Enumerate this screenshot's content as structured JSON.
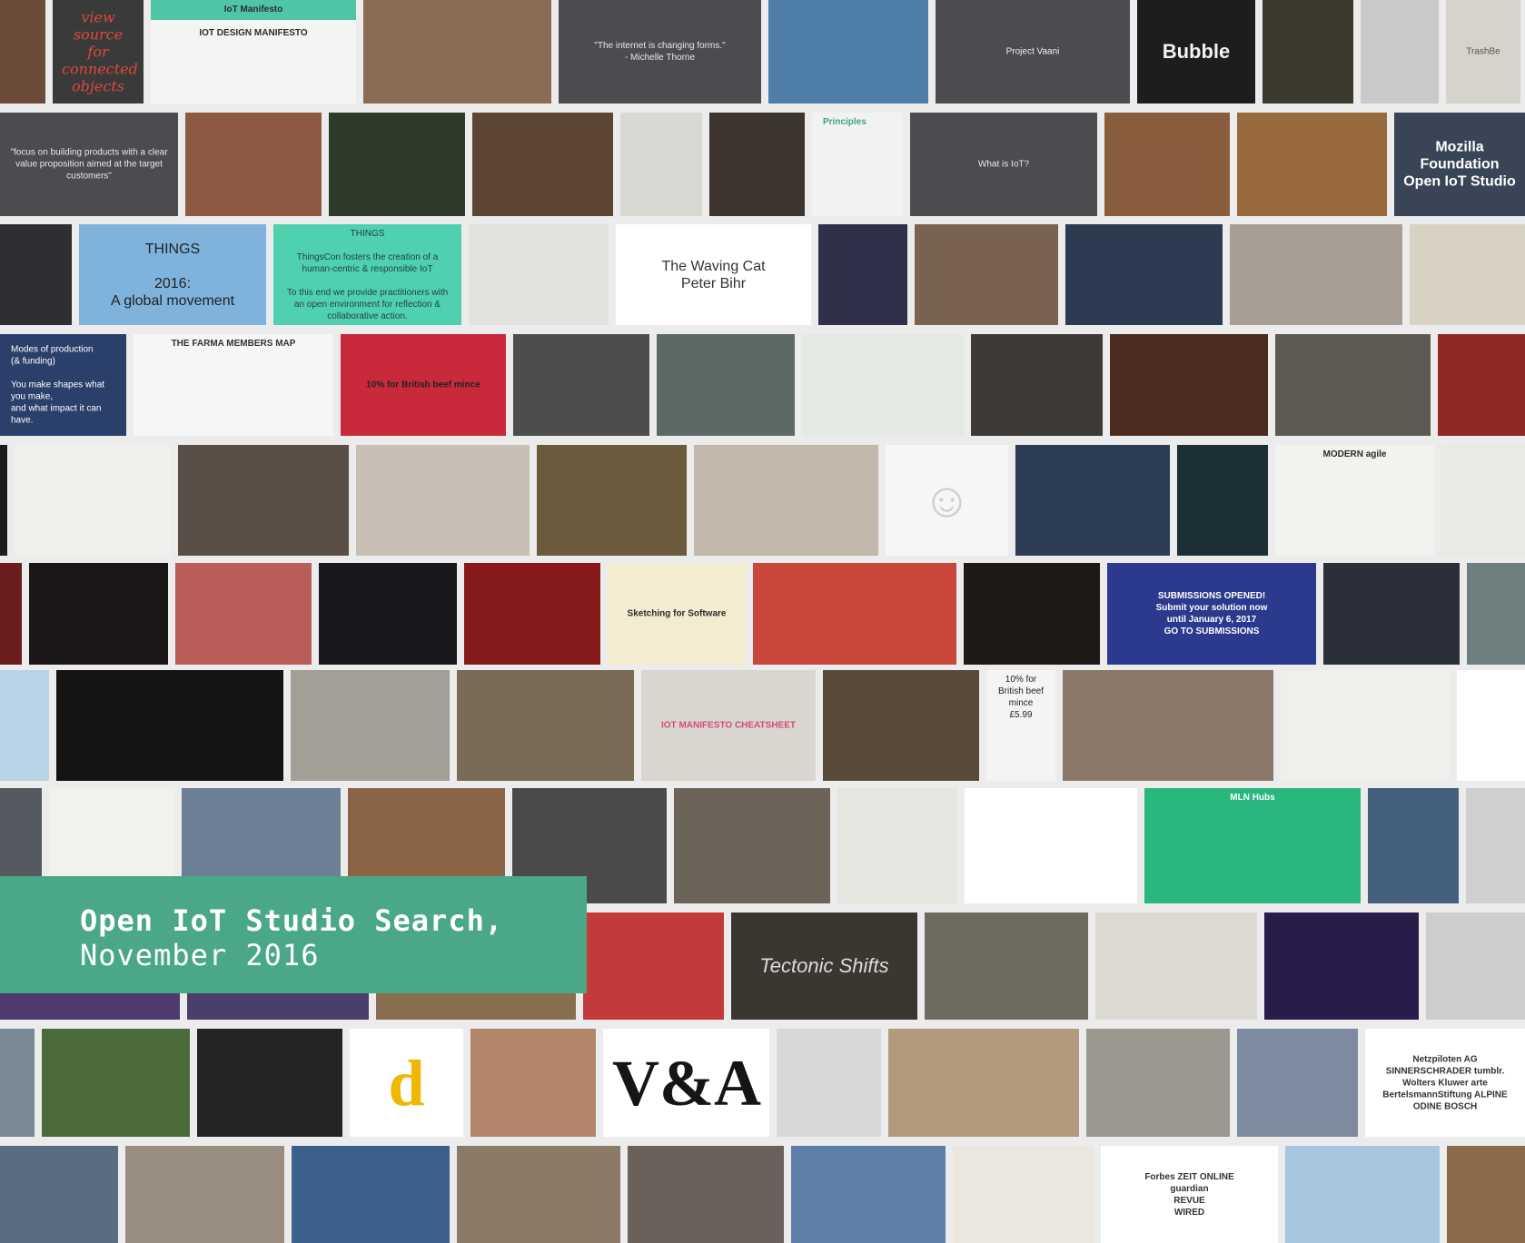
{
  "title": {
    "line1": "Open IoT Studio Search,",
    "line2": "November 2016"
  },
  "rows": [
    {
      "name": "row-1",
      "tiles": [
        {
          "w": 52,
          "bg": "#6b4a3a",
          "name": "workshop-photo-tile"
        },
        {
          "w": 100,
          "bg": "#3b3a3a",
          "text": "view source\nfor\nconnected\nobjects",
          "color": "#e0473a",
          "style": "big script",
          "name": "handwritten-note-tile"
        },
        {
          "w": 226,
          "bg": "#f4f4f2",
          "text": "IoT Manifesto\n\nIOT DESIGN MANIFESTO",
          "color": "#2d2d2d",
          "style": "top bold",
          "band": "#4ec5a5",
          "name": "iot-manifesto-tile"
        },
        {
          "w": 207,
          "bg": "#8a6b55",
          "name": "crowd-photo-tile"
        },
        {
          "w": 223,
          "bg": "#4a4c50",
          "text": "\"The internet is changing forms.\"\n- Michelle Thorne",
          "color": "#e8e8e8",
          "name": "quote-slide-tile"
        },
        {
          "w": 176,
          "bg": "#4f7fa8",
          "name": "coastal-town-photo-tile"
        },
        {
          "w": 214,
          "bg": "#4a4c50",
          "text": "Project Vaani",
          "color": "#f0f0f0",
          "name": "project-vaani-slide-tile"
        },
        {
          "w": 130,
          "bg": "#1d1d1d",
          "text": "Bubble",
          "color": "#f2f2f2",
          "style": "bigger bold",
          "name": "bubble-device-tile"
        },
        {
          "w": 100,
          "bg": "#3c3a2e",
          "name": "audience-photo-tile"
        },
        {
          "w": 86,
          "bg": "#c9c9c9",
          "name": "tablet-video-tile"
        },
        {
          "w": 82,
          "bg": "#d6d2cc",
          "text": "TrashBe",
          "color": "#555555",
          "name": "trashbe-tile"
        }
      ]
    },
    {
      "name": "row-2",
      "tiles": [
        {
          "w": 196,
          "bg": "#4a4c50",
          "text": "\"focus on building products with a clear value proposition aimed at the target customers\"",
          "color": "#e8e8e8",
          "name": "quote-slide-tile"
        },
        {
          "w": 150,
          "bg": "#8e5a43",
          "name": "red-phonebox-photo-tile"
        },
        {
          "w": 150,
          "bg": "#2f3b2a",
          "name": "graffiti-wall-photo-tile"
        },
        {
          "w": 155,
          "bg": "#5d4533",
          "name": "maker-table-photo-tile"
        },
        {
          "w": 90,
          "bg": "#d9d9d4",
          "name": "sketchbook-photo-tile"
        },
        {
          "w": 105,
          "bg": "#3e3530",
          "name": "hand-photo-tile"
        },
        {
          "w": 100,
          "bg": "#f2f2f2",
          "text": "Principles",
          "color": "#3aa57f",
          "style": "top bold left",
          "name": "principles-slide-tile"
        },
        {
          "w": 206,
          "bg": "#4a4c50",
          "text": "What is IoT?",
          "color": "#e8e8e8",
          "name": "what-is-iot-slide-tile"
        },
        {
          "w": 138,
          "bg": "#8a5e3d",
          "name": "studio-interior-photo-tile"
        },
        {
          "w": 165,
          "bg": "#9a6a3f",
          "name": "kitchen-photo-tile"
        },
        {
          "w": 179,
          "bg": "#394556",
          "text": "Mozilla Foundation\nOpen IoT Studio",
          "color": "#ffffff",
          "style": "big bold",
          "name": "mozilla-foundation-tile"
        }
      ]
    },
    {
      "name": "row-3",
      "tiles": [
        {
          "w": 79,
          "bg": "#2d2f33",
          "name": "dark-code-slide-tile"
        },
        {
          "w": 206,
          "bg": "#7fb3dc",
          "text": "THINGS\n\n2016:\nA global movement",
          "color": "#222222",
          "style": "big",
          "name": "global-movement-map-tile"
        },
        {
          "w": 207,
          "bg": "#4fd1b1",
          "text": "THINGS\n\nThingsCon fosters the creation of a human-centric & responsible IoT\n\nTo this end we provide practitioners with an open environment for reflection & collaborative action.",
          "color": "#1f3d4a",
          "name": "thingscon-slide-tile"
        },
        {
          "w": 154,
          "bg": "#e3e1dc",
          "name": "drawing-sheet-tile"
        },
        {
          "w": 215,
          "bg": "#ffffff",
          "text": "The Waving Cat\nPeter Bihr",
          "color": "#333333",
          "style": "big",
          "name": "waving-cat-slide-tile"
        },
        {
          "w": 98,
          "bg": "#30304a",
          "name": "baby-photo-tile"
        },
        {
          "w": 158,
          "bg": "#7a6250",
          "name": "children-group-photo-tile"
        },
        {
          "w": 173,
          "bg": "#2d3b52",
          "name": "classroom-photo-tile"
        },
        {
          "w": 190,
          "bg": "#a79f95",
          "name": "cardboard-device-photo-tile"
        },
        {
          "w": 159,
          "bg": "#d8d2c3",
          "name": "sensor-board-photo-tile"
        }
      ]
    },
    {
      "name": "row-4",
      "tiles": [
        {
          "w": 139,
          "bg": "#2b3f6b",
          "text": "Modes of production\n(& funding)\n\nYou make shapes what you make,\nand what impact it can have.",
          "color": "#ffffff",
          "style": "left",
          "name": "modes-of-production-slide-tile"
        },
        {
          "w": 220,
          "bg": "#f6f6f6",
          "text": "THE FARMA MEMBERS MAP",
          "color": "#333333",
          "style": "top bold",
          "name": "farma-members-map-tile"
        },
        {
          "w": 182,
          "bg": "#c82a3c",
          "text": "10% for British beef mince",
          "color": "#222222",
          "style": "bold",
          "name": "mince-package-tile"
        },
        {
          "w": 150,
          "bg": "#4d4d4d",
          "name": "bubble-prototype-photo-tile"
        },
        {
          "w": 152,
          "bg": "#5b6a66",
          "name": "rocky-shore-photo-tile"
        },
        {
          "w": 178,
          "bg": "#e5e9e4",
          "name": "map-pins-tile"
        },
        {
          "w": 145,
          "bg": "#3e3a36",
          "name": "selfie-photo-tile"
        },
        {
          "w": 174,
          "bg": "#4a2d20",
          "name": "crowd-audience-photo-tile"
        },
        {
          "w": 171,
          "bg": "#5d5a52",
          "name": "boat-photo-tile"
        },
        {
          "w": 148,
          "bg": "#8e2a26",
          "name": "phonebox-garden-photo-tile"
        }
      ]
    },
    {
      "name": "row-5",
      "tiles": [
        {
          "w": 8,
          "bg": "#1d1d1d",
          "name": "edge-photo-tile"
        },
        {
          "w": 172,
          "bg": "#f0f0ec",
          "name": "circuit-sketch-tile"
        },
        {
          "w": 188,
          "bg": "#5a4f46",
          "name": "laser-cutter-photo-tile"
        },
        {
          "w": 191,
          "bg": "#c7bfb3",
          "name": "wooden-box-led-tile"
        },
        {
          "w": 165,
          "bg": "#6b5a3c",
          "name": "hall-interior-photo-tile"
        },
        {
          "w": 203,
          "bg": "#c2b8ab",
          "name": "led-clock-box-tile"
        },
        {
          "w": 135,
          "bg": "#f6f6f6",
          "glyph": "☺",
          "color": "#cfcfcf",
          "name": "group-avatar-icon"
        },
        {
          "w": 170,
          "bg": "#2c3c55",
          "name": "workshop-room-photo-tile"
        },
        {
          "w": 100,
          "bg": "#1c2e36",
          "name": "presenter-screen-photo-tile"
        },
        {
          "w": 175,
          "bg": "#f2f2ee",
          "text": "MODERN agile",
          "color": "#2a2a2a",
          "style": "top bold",
          "name": "modern-agile-sketchnote-tile"
        },
        {
          "w": 150,
          "bg": "#e9eae6",
          "name": "circuit-board-photo-tile"
        }
      ]
    },
    {
      "name": "row-6",
      "tiles": [
        {
          "w": 24,
          "bg": "#6a1d1d",
          "name": "edge-photo-tile"
        },
        {
          "w": 153,
          "bg": "#1a1716",
          "name": "night-hall-photo-tile"
        },
        {
          "w": 150,
          "bg": "#b85d58",
          "name": "party-photo-tile"
        },
        {
          "w": 152,
          "bg": "#19191d",
          "name": "night-building-photo-tile"
        },
        {
          "w": 150,
          "bg": "#861a1a",
          "name": "red-hall-photo-tile"
        },
        {
          "w": 152,
          "bg": "#f4ecd0",
          "text": "Sketching for Software",
          "color": "#2a2a2a",
          "style": "bold",
          "name": "sketching-for-software-tile"
        },
        {
          "w": 224,
          "bg": "#c8473a",
          "name": "octopus-tentacle-photo-tile"
        },
        {
          "w": 150,
          "bg": "#1e1a17",
          "name": "illuminated-facade-photo-tile"
        },
        {
          "w": 230,
          "bg": "#2b3a8c",
          "text": "SUBMISSIONS OPENED!\nSubmit your solution now\nuntil January 6, 2017\nGO TO SUBMISSIONS",
          "color": "#ffffff",
          "style": "bold",
          "name": "submissions-opened-banner-tile"
        },
        {
          "w": 150,
          "bg": "#2a2f3a",
          "name": "presentation-screen-photo-tile"
        },
        {
          "w": 94,
          "bg": "#6f7e7e",
          "name": "lab-equipment-photo-tile"
        }
      ]
    },
    {
      "name": "row-7",
      "tiles": [
        {
          "w": 54,
          "bg": "#b9d3e6",
          "name": "map-edge-tile"
        },
        {
          "w": 250,
          "bg": "#141414",
          "name": "portrait-photo-tile"
        },
        {
          "w": 175,
          "bg": "#a39f97",
          "name": "metal-sculpture-photo-tile"
        },
        {
          "w": 195,
          "bg": "#7a6a58",
          "name": "exhibition-photo-tile"
        },
        {
          "w": 192,
          "bg": "#d9d6cf",
          "text": "IOT MANIFESTO CHEATSHEET",
          "color": "#d24a7a",
          "style": "bold",
          "name": "manifesto-cheatsheet-photo-tile"
        },
        {
          "w": 172,
          "bg": "#5a4a3c",
          "name": "wooden-shelf-photo-tile"
        },
        {
          "w": 76,
          "bg": "#f4f4f4",
          "text": "10% for British beef mince\n£5.99",
          "color": "#222222",
          "style": "top",
          "name": "mince-label-tile"
        },
        {
          "w": 232,
          "bg": "#8a7968",
          "name": "meeting-table-photo-tile"
        },
        {
          "w": 186,
          "bg": "#f0efec",
          "name": "product-box-photo-tile"
        },
        {
          "w": 125,
          "bg": "#ffffff",
          "name": "pixel-art-character-tile"
        }
      ]
    },
    {
      "name": "row-8",
      "tiles": [
        {
          "w": 46,
          "bg": "#555a60",
          "name": "edge-photo-tile"
        },
        {
          "w": 138,
          "bg": "#f3f1ed",
          "name": "smiling-woman-photo-tile"
        },
        {
          "w": 175,
          "bg": "#6d7f95",
          "name": "harbour-photo-tile"
        },
        {
          "w": 173,
          "bg": "#8a6447",
          "name": "tabletop-game-photo-tile"
        },
        {
          "w": 170,
          "bg": "#4b4a4a",
          "name": "open-office-photo-tile"
        },
        {
          "w": 172,
          "bg": "#6c6458",
          "name": "networking-event-photo-tile"
        },
        {
          "w": 132,
          "bg": "#e7e5e0",
          "name": "man-portrait-photo-tile"
        },
        {
          "w": 190,
          "bg": "#ffffff",
          "name": "signal-flags-chart-tile"
        },
        {
          "w": 238,
          "bg": "#29b77d",
          "text": "MLN Hubs",
          "color": "#ffffff",
          "style": "top bold",
          "name": "mln-hubs-slide-tile"
        },
        {
          "w": 100,
          "bg": "#45607c",
          "name": "overhead-workshop-photo-tile"
        },
        {
          "w": 100,
          "bg": "#cfcfcf",
          "name": "wood-sign-photo-tile"
        }
      ]
    },
    {
      "name": "row-9",
      "tiles": [
        {
          "w": 198,
          "bg": "#4e3a6c",
          "name": "purple-edge-tile"
        },
        {
          "w": 200,
          "bg": "#4a3f6a",
          "name": "purple-slide-tile"
        },
        {
          "w": 220,
          "bg": "#8a6e50",
          "name": "wood-edge-tile"
        },
        {
          "w": 155,
          "bg": "#c43a3a",
          "name": "conference-stage-photo-tile"
        },
        {
          "w": 205,
          "bg": "#3b3630",
          "text": "Tectonic Shifts",
          "color": "#dcdcdc",
          "style": "bigger italic",
          "name": "tectonic-shifts-slide-tile"
        },
        {
          "w": 180,
          "bg": "#6e6a60",
          "name": "chalkboard-people-photo-tile"
        },
        {
          "w": 178,
          "bg": "#dcd8d2",
          "name": "photo-collage-tile"
        },
        {
          "w": 170,
          "bg": "#2a1c4a",
          "name": "stage-lights-photo-tile"
        },
        {
          "w": 173,
          "bg": "#cdcdcd",
          "name": "white-gallery-photo-tile"
        }
      ]
    },
    {
      "name": "row-10",
      "tiles": [
        {
          "w": 38,
          "bg": "#7a8894",
          "name": "edge-photo-tile"
        },
        {
          "w": 163,
          "bg": "#4c6a3a",
          "name": "solar-panel-photo-tile"
        },
        {
          "w": 160,
          "bg": "#242424",
          "name": "gadget-table-photo-tile"
        },
        {
          "w": 125,
          "bg": "#ffffff",
          "text": "d",
          "color": "#f1b600",
          "style": "huge",
          "name": "yellow-logo-tile"
        },
        {
          "w": 138,
          "bg": "#b3866a",
          "name": "metal-shapes-photo-tile"
        },
        {
          "w": 183,
          "bg": "#ffffff",
          "text": "V&A",
          "color": "#151515",
          "style": "huge",
          "name": "v-and-a-logo-tile"
        },
        {
          "w": 115,
          "bg": "#d8d8d8",
          "name": "metal-chair-photo-tile"
        },
        {
          "w": 210,
          "bg": "#b29a7c",
          "name": "dinosaur-cutout-photo-tile"
        },
        {
          "w": 158,
          "bg": "#9b9890",
          "name": "cat-photo-tile"
        },
        {
          "w": 133,
          "bg": "#7e8aa0",
          "name": "museum-building-photo-tile"
        },
        {
          "w": 183,
          "bg": "#ffffff",
          "text": "Netzpiloten AG\nSINNERSCHRADER   tumblr.\nWolters Kluwer   arte\nBertelsmannStiftung   ALPINE\nODINE   BOSCH",
          "color": "#333333",
          "style": "bold",
          "name": "partner-logos-tile"
        }
      ]
    },
    {
      "name": "row-11",
      "tiles": [
        {
          "w": 130,
          "bg": "#5a6d80",
          "name": "city-skyline-photo-tile"
        },
        {
          "w": 175,
          "bg": "#9a8e80",
          "name": "greenhouse-structure-photo-tile"
        },
        {
          "w": 174,
          "bg": "#3d5f8c",
          "name": "glass-tower-photo-tile"
        },
        {
          "w": 180,
          "bg": "#8c7a68",
          "name": "pendant-lamps-photo-tile"
        },
        {
          "w": 172,
          "bg": "#6a625a",
          "name": "wall-buttons-photo-tile"
        },
        {
          "w": 170,
          "bg": "#5e7fa8",
          "name": "modern-building-photo-tile"
        },
        {
          "w": 155,
          "bg": "#ece7de",
          "name": "route-map-tile"
        },
        {
          "w": 195,
          "bg": "#ffffff",
          "text": "Forbes   ZEIT ONLINE\nguardian\nREVUE\nWIRED",
          "color": "#333333",
          "style": "bold",
          "name": "media-logos-tile"
        },
        {
          "w": 170,
          "bg": "#a6c6e0",
          "name": "finland-map-tile"
        },
        {
          "w": 148,
          "bg": "#8a6a4a",
          "name": "alpine-town-photo-tile"
        }
      ]
    }
  ]
}
